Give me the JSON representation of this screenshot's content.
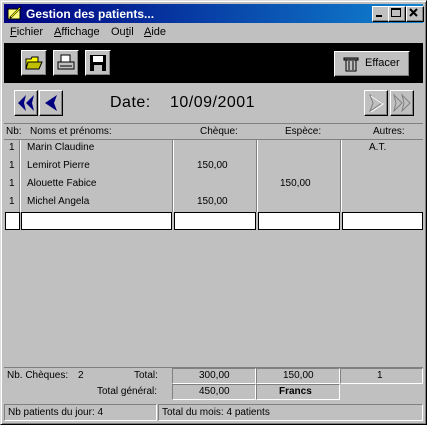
{
  "window": {
    "title": "Gestion des patients..."
  },
  "menu": [
    {
      "label": "Fichier",
      "ul": "F",
      "rest": "ichier"
    },
    {
      "label": "Affichage",
      "ul": "A",
      "rest": "ffichage"
    },
    {
      "label": "Outil",
      "pre": "Ou",
      "ul": "t",
      "rest": "il"
    },
    {
      "label": "Aide",
      "ul": "A",
      "rest": "ide"
    }
  ],
  "toolbar": {
    "effacer_label": "Effacer"
  },
  "nav": {
    "date_label": "Date:",
    "date_value": "10/09/2001"
  },
  "table": {
    "headers": {
      "nb": "Nb:",
      "name": "Noms et prénoms:",
      "cheque": "Chèque:",
      "espece": "Espèce:",
      "autres": "Autres:"
    },
    "rows": [
      {
        "nb": "1",
        "name": "Marin Claudine",
        "cheque": "",
        "espece": "",
        "autres": "A.T."
      },
      {
        "nb": "1",
        "name": "Lemirot Pierre",
        "cheque": "150,00",
        "espece": "",
        "autres": ""
      },
      {
        "nb": "1",
        "name": "Alouette Fabice",
        "cheque": "",
        "espece": "150,00",
        "autres": ""
      },
      {
        "nb": "1",
        "name": "Michel Angela",
        "cheque": "150,00",
        "espece": "",
        "autres": ""
      }
    ]
  },
  "footer": {
    "nb_cheques_label": "Nb. Chèques:",
    "nb_cheques_value": "2",
    "total_label": "Total:",
    "total_cheque": "300,00",
    "total_espece": "150,00",
    "total_autres": "1",
    "total_general_label": "Total général:",
    "total_general_value": "450,00",
    "currency": "Francs"
  },
  "status": {
    "patients_jour": "Nb patients du jour: 4",
    "total_mois": "Total du mois: 4 patients"
  },
  "colors": {
    "title_start": "#000080",
    "title_end": "#1084d0",
    "face": "#c0c0c0",
    "nav_arrow": "#000080"
  }
}
